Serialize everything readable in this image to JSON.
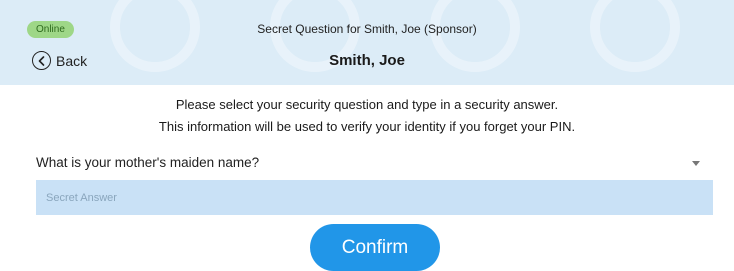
{
  "header": {
    "status": "Online",
    "title": "Secret Question for Smith, Joe (Sponsor)",
    "back_label": "Back",
    "name": "Smith, Joe"
  },
  "instructions": {
    "line1": "Please select your security question and type in a security answer.",
    "line2": "This information will be used to verify your identity if you forget your PIN."
  },
  "form": {
    "question_selected": "What is your mother's maiden name?",
    "answer_value": "",
    "answer_placeholder": "Secret Answer",
    "confirm_label": "Confirm"
  },
  "colors": {
    "header_bg": "#dcecf7",
    "status_badge": "#9ed787",
    "input_bg": "#c9e1f6",
    "confirm_button": "#2196e8"
  },
  "icons": {
    "back": "back-circle-icon",
    "dropdown": "chevron-down-icon"
  }
}
